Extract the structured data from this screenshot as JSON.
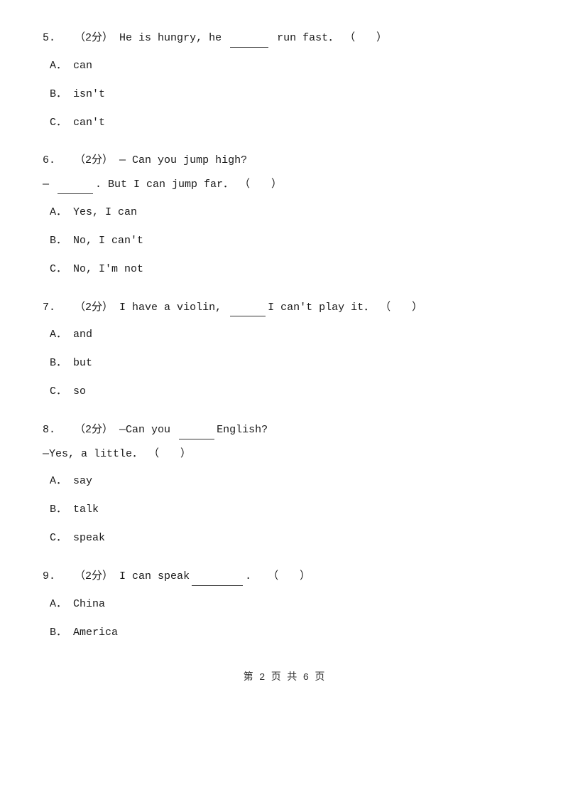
{
  "questions": [
    {
      "id": "q5",
      "number": "5.",
      "points": "（2分）",
      "text": "He is hungry, he ______ run fast．（　　）",
      "blank_label": "______",
      "options": [
        {
          "label": "A．",
          "text": "can"
        },
        {
          "label": "B．",
          "text": "isn't"
        },
        {
          "label": "C．",
          "text": "can't"
        }
      ]
    },
    {
      "id": "q6",
      "number": "6.",
      "points": "（2分）",
      "text": "— Can you jump high?",
      "follow_text": "— ______. But I can jump far．（　　）",
      "options": [
        {
          "label": "A．",
          "text": "Yes, I can"
        },
        {
          "label": "B．",
          "text": "No, I can't"
        },
        {
          "label": "C．",
          "text": "No, I'm not"
        }
      ]
    },
    {
      "id": "q7",
      "number": "7.",
      "points": "（2分）",
      "text": "I have a violin, ______I can't play it．（　　）",
      "options": [
        {
          "label": "A．",
          "text": "and"
        },
        {
          "label": "B．",
          "text": "but"
        },
        {
          "label": "C．",
          "text": "so"
        }
      ]
    },
    {
      "id": "q8",
      "number": "8.",
      "points": "（2分）",
      "text": "—Can you ______English?",
      "follow_text": "—Yes, a little．（　　）",
      "options": [
        {
          "label": "A．",
          "text": "say"
        },
        {
          "label": "B．",
          "text": "talk"
        },
        {
          "label": "C．",
          "text": "speak"
        }
      ]
    },
    {
      "id": "q9",
      "number": "9.",
      "points": "（2分）",
      "text": "I can speak________.　（　　）",
      "options": [
        {
          "label": "A．",
          "text": "China"
        },
        {
          "label": "B．",
          "text": "America"
        }
      ]
    }
  ],
  "footer": {
    "text": "第 2 页 共 6 页"
  }
}
